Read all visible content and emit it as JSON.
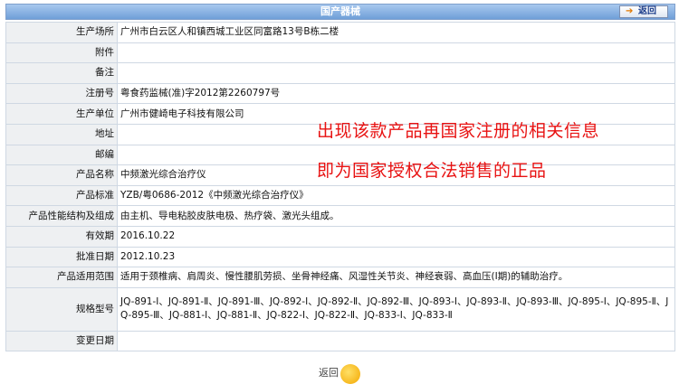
{
  "header": {
    "title": "国产器械",
    "back_label": "返回"
  },
  "rows": [
    {
      "label": "生产场所",
      "value": "广州市白云区人和镇西城工业区同富路13号B栋二楼"
    },
    {
      "label": "附件",
      "value": ""
    },
    {
      "label": "备注",
      "value": ""
    },
    {
      "label": "注册号",
      "value": "粤食药监械(准)字2012第2260797号"
    },
    {
      "label": "生产单位",
      "value": "广州市健崎电子科技有限公司"
    },
    {
      "label": "地址",
      "value": ""
    },
    {
      "label": "邮编",
      "value": ""
    },
    {
      "label": "产品名称",
      "value": "中频激光综合治疗仪"
    },
    {
      "label": "产品标准",
      "value": "YZB/粤0686-2012《中频激光综合治疗仪》"
    },
    {
      "label": "产品性能结构及组成",
      "value": "由主机、导电粘胶皮肤电极、热疗袋、激光头组成。"
    },
    {
      "label": "有效期",
      "value": "2016.10.22"
    },
    {
      "label": "批准日期",
      "value": "2012.10.23"
    },
    {
      "label": "产品适用范围",
      "value": "适用于颈椎病、肩周炎、慢性腰肌劳损、坐骨神经痛、风湿性关节炎、神经衰弱、高血压(Ⅰ期)的辅助治疗。"
    },
    {
      "label": "规格型号",
      "value": "JQ-891-Ⅰ、JQ-891-Ⅱ、JQ-891-Ⅲ、JQ-892-Ⅰ、JQ-892-Ⅱ、JQ-892-Ⅲ、JQ-893-Ⅰ、JQ-893-Ⅱ、JQ-893-Ⅲ、JQ-895-Ⅰ、JQ-895-Ⅱ、JQ-895-Ⅲ、JQ-881-Ⅰ、JQ-881-Ⅱ、JQ-822-Ⅰ、JQ-822-Ⅱ、JQ-833-Ⅰ、JQ-833-Ⅱ"
    },
    {
      "label": "变更日期",
      "value": ""
    }
  ],
  "annotation": {
    "line1": "出现该款产品再国家注册的相关信息",
    "line2": "即为国家授权合法销售的正品"
  },
  "footer": {
    "back_label": "返回"
  },
  "colors": {
    "annotation": "#e81212",
    "label_bg": "#eef0f2",
    "header_bg": "#6f9fd8"
  }
}
